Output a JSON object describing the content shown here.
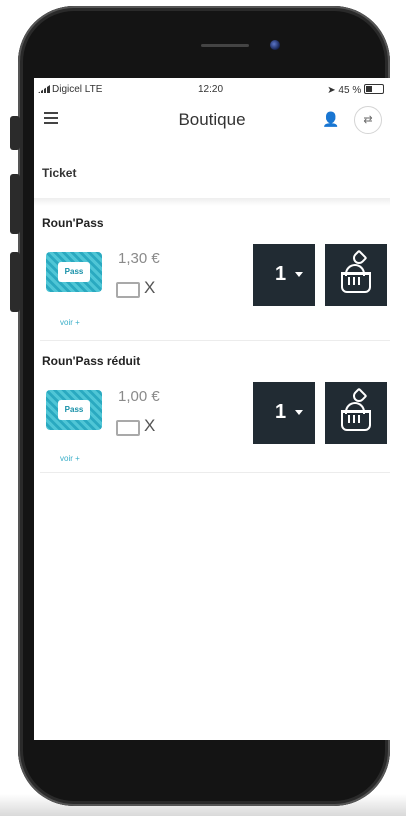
{
  "status": {
    "carrier": "Digicel LTE",
    "time": "12:20",
    "battery": "45 %"
  },
  "header": {
    "title": "Boutique"
  },
  "section": {
    "title": "Ticket"
  },
  "products": [
    {
      "name": "Roun'Pass",
      "pass_text": "Pass",
      "price": "1,30 €",
      "ticket_mark": "X",
      "details_link": "voir +",
      "quantity": "1"
    },
    {
      "name": "Roun'Pass réduit",
      "pass_text": "Pass",
      "price": "1,00 €",
      "ticket_mark": "X",
      "details_link": "voir +",
      "quantity": "1"
    }
  ]
}
